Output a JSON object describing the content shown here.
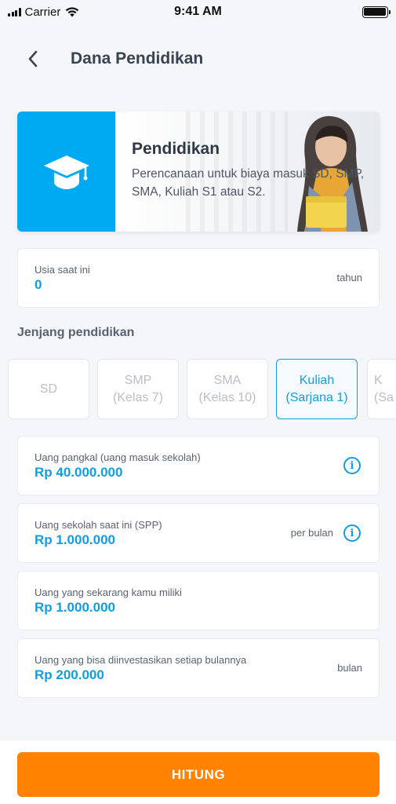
{
  "status_bar": {
    "carrier": "Carrier",
    "time": "9:41 AM"
  },
  "header": {
    "title": "Dana Pendidikan"
  },
  "hero": {
    "title": "Pendidikan",
    "description": "Perencanaan untuk biaya masuk SD, SMP, SMA, Kuliah S1 atau S2.",
    "icon": "graduation-cap-icon",
    "accent_color": "#00aaf2"
  },
  "age": {
    "label": "Usia saat ini",
    "value": "0",
    "suffix": "tahun"
  },
  "education_section": {
    "title": "Jenjang pendidikan",
    "levels": [
      {
        "line1": "SD",
        "line2": "",
        "selected": false
      },
      {
        "line1": "SMP",
        "line2": "(Kelas 7)",
        "selected": false
      },
      {
        "line1": "SMA",
        "line2": "(Kelas 10)",
        "selected": false
      },
      {
        "line1": "Kuliah",
        "line2": "(Sarjana 1)",
        "selected": true
      },
      {
        "line1": "K",
        "line2": "(Sa",
        "selected": false
      }
    ]
  },
  "fields": {
    "entrance_fee": {
      "label": "Uang pangkal (uang masuk sekolah)",
      "value": "Rp 40.000.000"
    },
    "spp": {
      "label": "Uang sekolah saat ini (SPP)",
      "value": "Rp 1.000.000",
      "suffix": "per bulan"
    },
    "savings": {
      "label": "Uang yang sekarang kamu miliki",
      "value": "Rp 1.000.000"
    },
    "monthly_invest": {
      "label": "Uang yang bisa diinvestasikan setiap bulannya",
      "value": "Rp 200.000",
      "suffix": "bulan"
    }
  },
  "actions": {
    "calculate_label": "HITUNG",
    "button_color": "#ff8200"
  },
  "colors": {
    "value_blue": "#109ee0",
    "background": "#f4f6fa"
  }
}
